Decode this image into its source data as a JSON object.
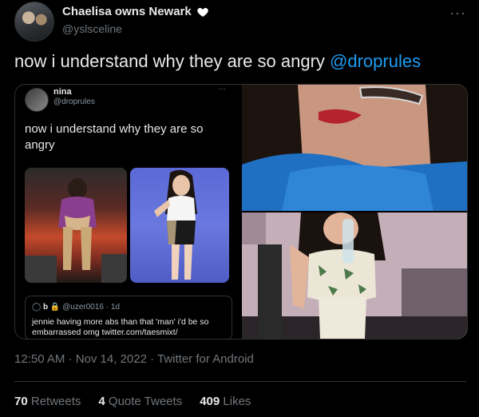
{
  "author": {
    "display_name": "Chaelisa owns Newark",
    "handle": "@yslsceline",
    "avatar_icon": "profile-photo",
    "badge_icon": "white-heart-icon"
  },
  "tweet": {
    "text": "now i understand why they are so angry",
    "mention": "@droprules",
    "timestamp": "12:50 AM · Nov 14, 2022 · Twitter for Android"
  },
  "quoted_screenshot": {
    "name": "nina",
    "handle": "@droprules",
    "text": "now i understand why they are so angry",
    "reply": {
      "user": "b",
      "handle": "@uzer0016 · 1d",
      "text": "jennie having more abs than that 'man' i'd be so embarrassed omg twitter.com/taesmixt/"
    }
  },
  "stats": [
    {
      "count": "70",
      "label": "Retweets"
    },
    {
      "count": "4",
      "label": "Quote Tweets"
    },
    {
      "count": "409",
      "label": "Likes"
    }
  ],
  "colors": {
    "background": "#000000",
    "accent": "#1d9bf0",
    "muted": "#71767b"
  }
}
